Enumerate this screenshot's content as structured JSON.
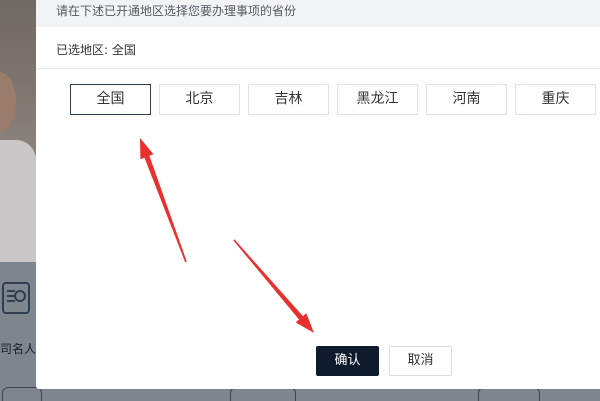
{
  "modal": {
    "instruction": "请在下述已开通地区选择您要办理事项的省份",
    "selected_label": "已选地区:",
    "selected_value": "全国",
    "regions": [
      {
        "label": "全国",
        "selected": true
      },
      {
        "label": "北京",
        "selected": false
      },
      {
        "label": "吉林",
        "selected": false
      },
      {
        "label": "黑龙江",
        "selected": false
      },
      {
        "label": "河南",
        "selected": false
      },
      {
        "label": "重庆",
        "selected": false
      }
    ],
    "confirm_label": "确认",
    "cancel_label": "取消"
  },
  "background": {
    "partial_text": "司名人"
  },
  "annotation": {
    "arrow_color": "#e8312f"
  },
  "colors": {
    "primary_button": "#0f1a2c",
    "selected_border": "#2c3e57"
  }
}
